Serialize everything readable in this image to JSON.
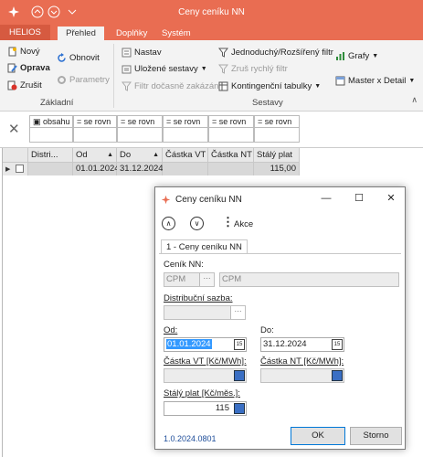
{
  "window": {
    "title": "Ceny ceníku NN"
  },
  "tabs": {
    "helios": "HELIOS",
    "items": [
      "Přehled",
      "Doplňky",
      "Systém"
    ]
  },
  "ribbon": {
    "novy": "Nový",
    "oprava": "Oprava",
    "zrusit": "Zrušit",
    "obnovit": "Obnovit",
    "parametry": "Parametry",
    "group_zakladni": "Základní",
    "nastav": "Nastav",
    "ulozene": "Uložené sestavy",
    "filtr_docasne": "Filtr dočasně zakázán",
    "jednoduchy": "Jednoduchý/Rozšířený filtr",
    "zrus_rychly": "Zruš rychlý filtr",
    "kontingencni": "Kontingenční tabulky",
    "grafy": "Grafy",
    "master": "Master x Detail",
    "group_sestavy": "Sestavy"
  },
  "filter": {
    "cells": [
      "obsahu",
      "se rovn",
      "se rovn",
      "se rovn",
      "se rovn",
      "se rovn"
    ]
  },
  "grid": {
    "headers": [
      "Distri...",
      "Od",
      "Do",
      "Částka VT",
      "Částka NT",
      "Stálý plat"
    ],
    "row": {
      "od": "01.01.2024",
      "do": "31.12.2024",
      "staly": "115,00"
    }
  },
  "dialog": {
    "title": "Ceny ceníku NN",
    "akce": "Akce",
    "tab": "1 - Ceny ceníku NN",
    "cenik_label": "Ceník NN:",
    "cenik_code": "CPM",
    "cenik_name": "CPM",
    "distribucni_label": "Distribuční sazba:",
    "od_label": "Od:",
    "od_value": "01.01.2024",
    "do_label": "Do:",
    "do_value": "31.12.2024",
    "vt_label": "Částka VT [Kč/MWh]:",
    "nt_label": "Částka NT [Kč/MWh]:",
    "staly_label": "Stálý plat [Kč/měs.]:",
    "staly_value": "115",
    "version": "1.0.2024.0801",
    "ok": "OK",
    "storno": "Storno"
  },
  "colors": {
    "accent": "#e96d52",
    "selection": "#3399ff"
  }
}
